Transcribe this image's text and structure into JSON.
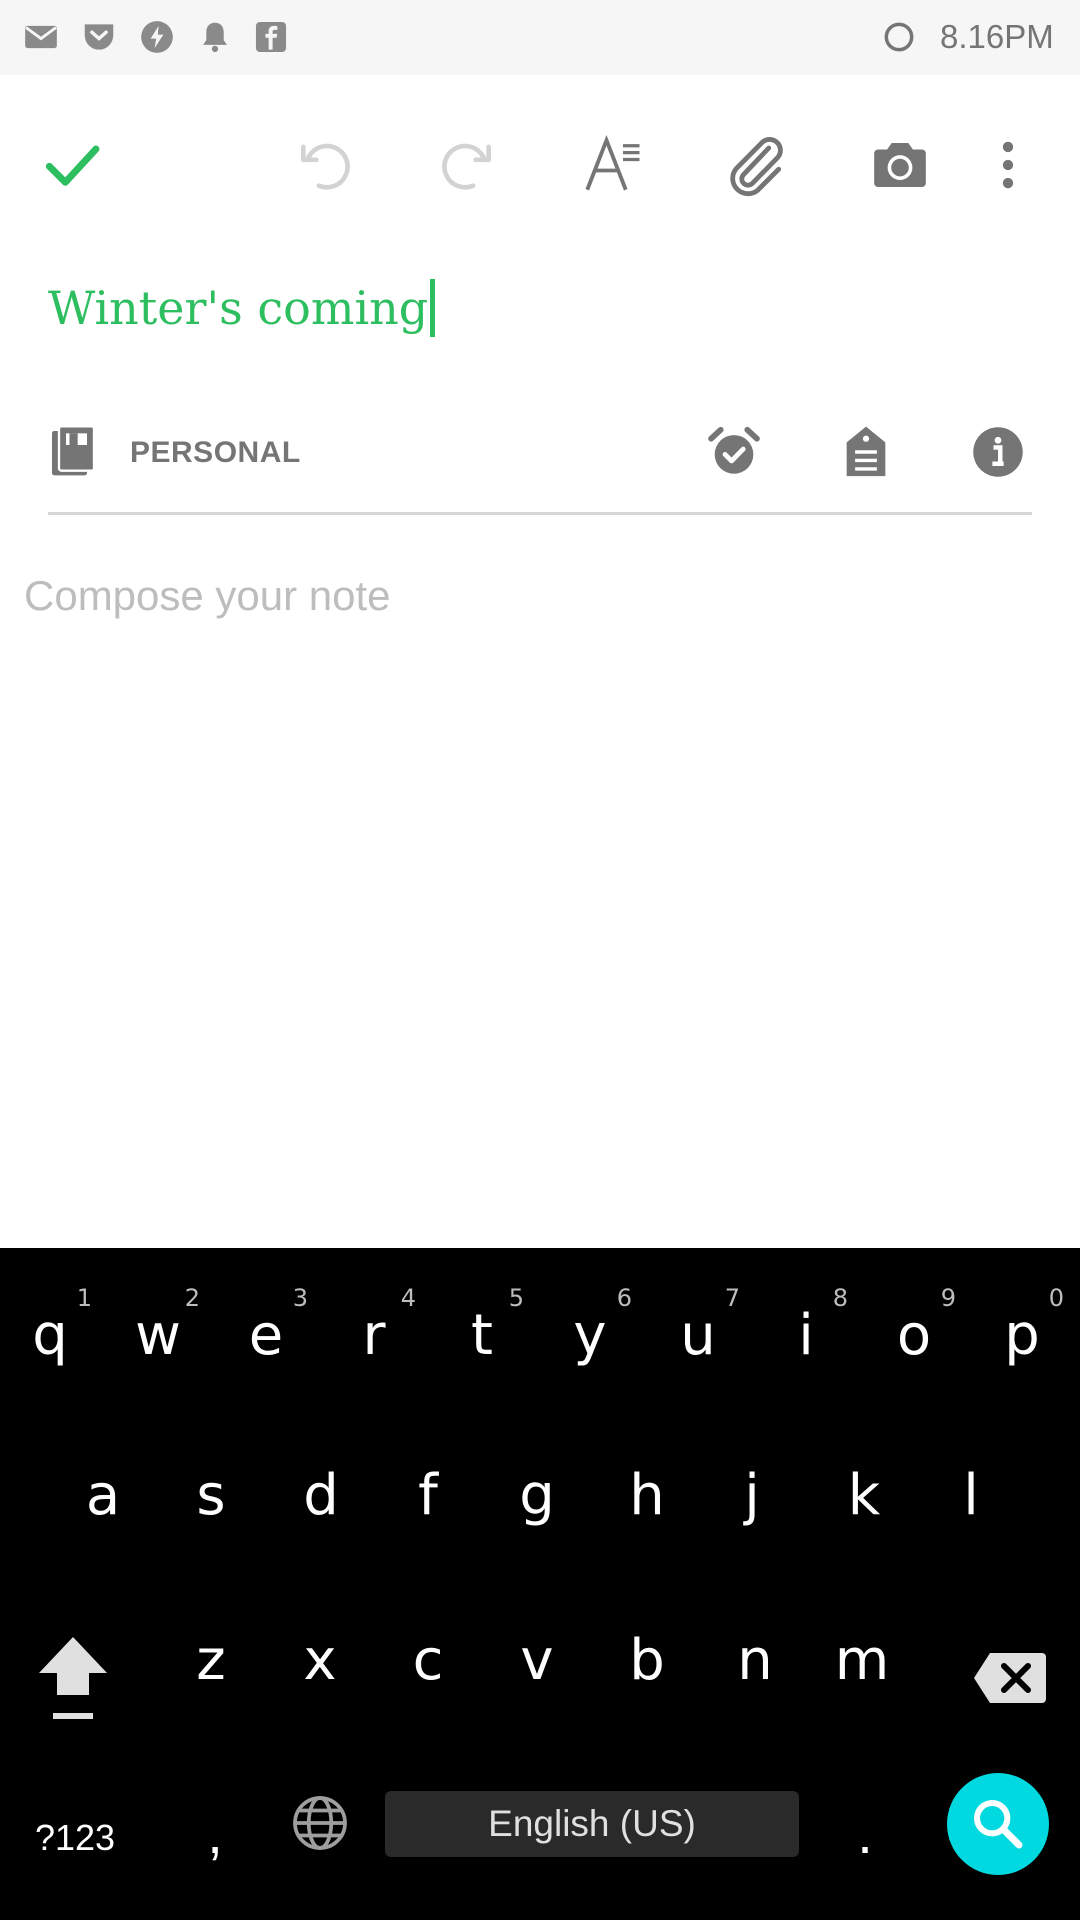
{
  "status_bar": {
    "time": "8.16PM",
    "icons": [
      "mail-icon",
      "pocket-icon",
      "bolt-icon",
      "bell-icon",
      "facebook-icon",
      "sync-circle-icon"
    ]
  },
  "toolbar": {
    "icons": [
      "checkmark-icon",
      "undo-icon",
      "redo-icon",
      "text-format-icon",
      "attachment-icon",
      "camera-icon",
      "more-vert-icon"
    ]
  },
  "note": {
    "title": "Winter's coming",
    "notebook": "PERSONAL",
    "body_placeholder": "Compose your note"
  },
  "colors": {
    "accent": "#2dbe60",
    "keyboard_bg": "#000000",
    "search_key": "#00d9e0",
    "icon_gray": "#757575"
  },
  "keyboard": {
    "row1": [
      {
        "letter": "q",
        "hint": "1"
      },
      {
        "letter": "w",
        "hint": "2"
      },
      {
        "letter": "e",
        "hint": "3"
      },
      {
        "letter": "r",
        "hint": "4"
      },
      {
        "letter": "t",
        "hint": "5"
      },
      {
        "letter": "y",
        "hint": "6"
      },
      {
        "letter": "u",
        "hint": "7"
      },
      {
        "letter": "i",
        "hint": "8"
      },
      {
        "letter": "o",
        "hint": "9"
      },
      {
        "letter": "p",
        "hint": "0"
      }
    ],
    "row2": [
      "a",
      "s",
      "d",
      "f",
      "g",
      "h",
      "j",
      "k",
      "l"
    ],
    "row3": [
      "z",
      "x",
      "c",
      "v",
      "b",
      "n",
      "m"
    ],
    "symbols_label": "?123",
    "comma": ",",
    "space_label": "English (US)",
    "period": "."
  }
}
